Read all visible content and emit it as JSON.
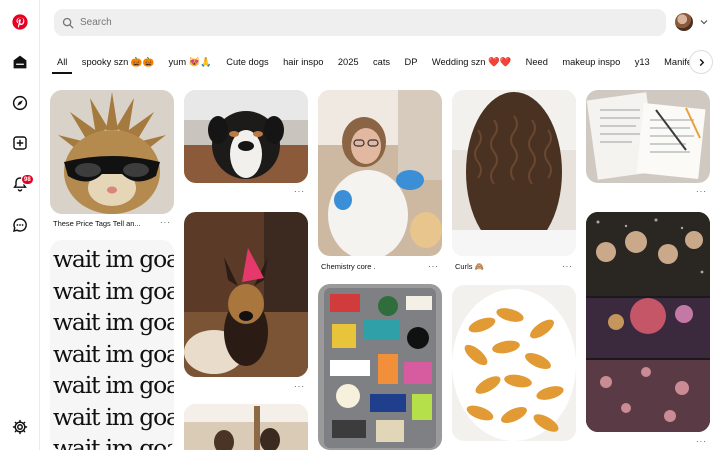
{
  "search": {
    "placeholder": "Search"
  },
  "notifications": {
    "count": "98"
  },
  "tabs": [
    "All",
    "spooky szn 🎃🎃",
    "yum 😻🙏",
    "Cute dogs",
    "hair inspo",
    "2025",
    "cats",
    "DP",
    "Wedding szn ❤️❤️",
    "Need",
    "makeup inspo",
    "y13",
    "Manifest"
  ],
  "pins": {
    "cat": {
      "caption": "These Price Tags Tell an..."
    },
    "goated": {
      "lines": [
        "wait im goated..",
        "wait im goated..",
        "wait im goated..",
        "wait im goated..",
        "wait im goated..",
        "wait im goated..",
        "wait im goated.."
      ]
    },
    "chemistry": {
      "caption": "Chemistry core ."
    },
    "curls": {
      "caption": "Curls 🙈"
    }
  },
  "colors": {
    "brand": "#e60023",
    "search_bg": "#efefef"
  }
}
